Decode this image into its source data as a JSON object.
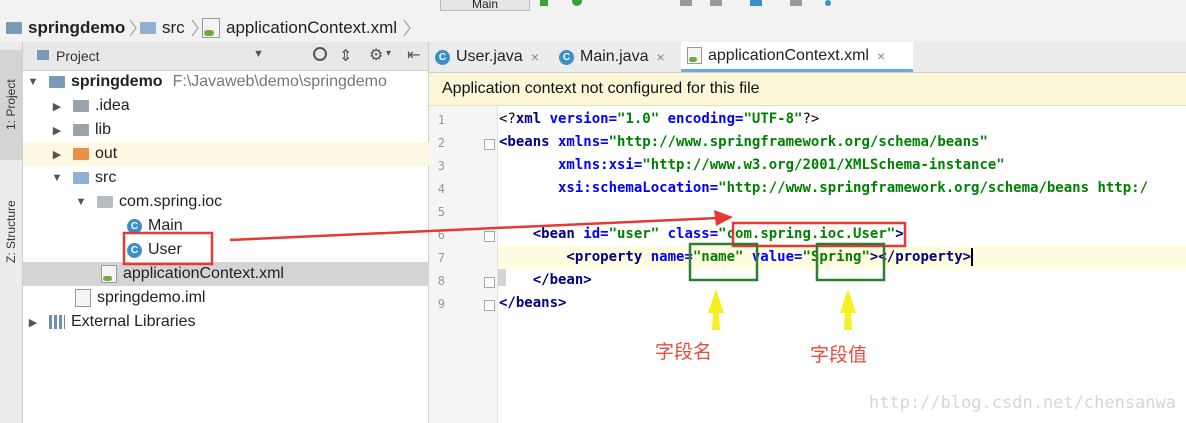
{
  "navbar": {
    "crumbs": [
      "springdemo",
      "src",
      "applicationContext.xml"
    ],
    "run_config": "Main"
  },
  "toolstrip": {
    "project_tab": "1: Project",
    "structure_tab": "Z: Structure"
  },
  "project": {
    "header_label": "Project",
    "tree": [
      {
        "label": "springdemo",
        "path": "F:\\Javaweb\\demo\\springdemo"
      },
      {
        "label": ".idea"
      },
      {
        "label": "lib"
      },
      {
        "label": "out"
      },
      {
        "label": "src"
      },
      {
        "label": "com.spring.ioc"
      },
      {
        "label": "Main"
      },
      {
        "label": "User"
      },
      {
        "label": "applicationContext.xml"
      },
      {
        "label": "springdemo.iml"
      },
      {
        "label": "External Libraries"
      }
    ]
  },
  "editor": {
    "tabs": [
      "User.java",
      "Main.java",
      "applicationContext.xml"
    ],
    "banner": "Application context not configured for this file",
    "line_numbers": [
      "1",
      "2",
      "3",
      "4",
      "5",
      "6",
      "7",
      "8",
      "9"
    ],
    "line1": {
      "a": "<?",
      "b": "xml",
      "c": " version=",
      "d": "\"1.0\"",
      "e": " encoding=",
      "f": "\"UTF-8\"",
      "g": "?>"
    },
    "line2": {
      "a": "<beans",
      "b": " xmlns=",
      "c": "\"http://www.springframework.org/schema/beans\""
    },
    "line3": {
      "a": "       xmlns:xsi=",
      "b": "\"http://www.w3.org/2001/XMLSchema-instance\""
    },
    "line4": {
      "a": "       xsi:schemaLocation=",
      "b": "\"http://www.springframework.org/schema/beans http:/"
    },
    "line6": {
      "a": "    <bean",
      "b": " id=",
      "c": "\"user\"",
      "d": " class=",
      "e": "\"com.spring.ioc.User\"",
      "f": ">"
    },
    "line7": {
      "a": "        <property",
      "b": " name=",
      "c": "\"name\"",
      "d": " value=",
      "e": "\"Spring\"",
      "f": "></property>"
    },
    "line8": {
      "a": "    </bean>"
    },
    "line9": {
      "a": "</beans>"
    }
  },
  "annotations": {
    "field_name": "字段名",
    "field_value": "字段值"
  },
  "watermark": "http://blog.csdn.net/chensanwa",
  "colors": {
    "annotation_red": "#e53935",
    "annotation_green": "#2e7d32",
    "annotation_arrow_yellow": "#f5ef24",
    "banner_bg": "#fbf7d8"
  }
}
